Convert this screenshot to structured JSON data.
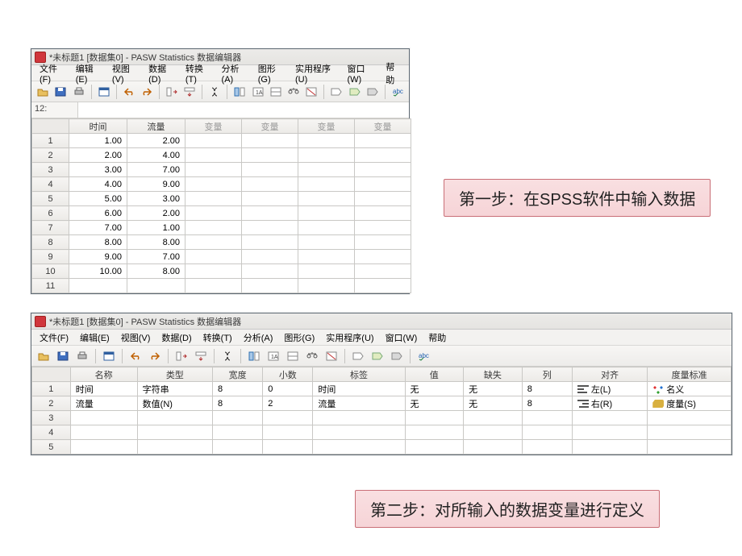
{
  "window1": {
    "title": "*未标题1 [数据集0] - PASW Statistics 数据编辑器",
    "cell_indicator": "12:",
    "menu": [
      "文件(F)",
      "编辑(E)",
      "视图(V)",
      "数据(D)",
      "转换(T)",
      "分析(A)",
      "图形(G)",
      "实用程序(U)",
      "窗口(W)",
      "帮助"
    ],
    "columns": [
      "时间",
      "流量",
      "变量",
      "变量",
      "变量",
      "变量"
    ],
    "rows": [
      {
        "n": "1",
        "time": "1.00",
        "flow": "2.00"
      },
      {
        "n": "2",
        "time": "2.00",
        "flow": "4.00"
      },
      {
        "n": "3",
        "time": "3.00",
        "flow": "7.00"
      },
      {
        "n": "4",
        "time": "4.00",
        "flow": "9.00"
      },
      {
        "n": "5",
        "time": "5.00",
        "flow": "3.00"
      },
      {
        "n": "6",
        "time": "6.00",
        "flow": "2.00"
      },
      {
        "n": "7",
        "time": "7.00",
        "flow": "1.00"
      },
      {
        "n": "8",
        "time": "8.00",
        "flow": "8.00"
      },
      {
        "n": "9",
        "time": "9.00",
        "flow": "7.00"
      },
      {
        "n": "10",
        "time": "10.00",
        "flow": "8.00"
      },
      {
        "n": "11",
        "time": "",
        "flow": ""
      }
    ]
  },
  "window2": {
    "title": "*未标题1 [数据集0] - PASW Statistics 数据编辑器",
    "menu": [
      "文件(F)",
      "编辑(E)",
      "视图(V)",
      "数据(D)",
      "转换(T)",
      "分析(A)",
      "图形(G)",
      "实用程序(U)",
      "窗口(W)",
      "帮助"
    ],
    "columns": [
      "名称",
      "类型",
      "宽度",
      "小数",
      "标签",
      "值",
      "缺失",
      "列",
      "对齐",
      "度量标准"
    ],
    "vars": [
      {
        "n": "1",
        "name": "时间",
        "type": "字符串",
        "width": "8",
        "dec": "0",
        "label": "时间",
        "values": "无",
        "missing": "无",
        "cols": "8",
        "align": "左(L)",
        "measure": "名义"
      },
      {
        "n": "2",
        "name": "流量",
        "type": "数值(N)",
        "width": "8",
        "dec": "2",
        "label": "流量",
        "values": "无",
        "missing": "无",
        "cols": "8",
        "align": "右(R)",
        "measure": "度量(S)"
      }
    ],
    "empty": [
      "3",
      "4",
      "5"
    ]
  },
  "callout1": "第一步：在SPSS软件中输入数据",
  "callout2": "第二步：对所输入的数据变量进行定义"
}
